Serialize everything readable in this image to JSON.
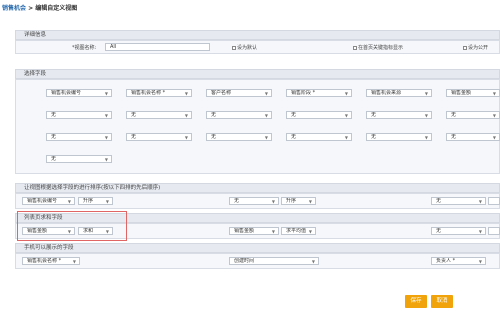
{
  "breadcrumb": {
    "link": "销售机会",
    "separator": " > ",
    "current": "编辑自定义视图"
  },
  "sections": {
    "details": "详细信息",
    "select_fields": "选择字段",
    "sort": "让视图根据选择字段的进行排序(按以下四排的先后顺序)",
    "summary": "列表页求和字段",
    "mobile": "手机可以展示的字段"
  },
  "details": {
    "view_name_label": "*视图名称:",
    "view_name_value": "All",
    "default_label": "设为默认",
    "home_key_label": "在首页关键指标显示",
    "public_label": "设为公开"
  },
  "fields": [
    [
      "销售机会编号",
      "销售机会名称 *",
      "客户名称",
      "销售阶段 *",
      "销售机会来源",
      "销售金额"
    ],
    [
      "无",
      "无",
      "无",
      "无",
      "无",
      "无"
    ],
    [
      "无",
      "无",
      "无",
      "无",
      "无",
      "无"
    ],
    [
      "无"
    ]
  ],
  "sort": [
    {
      "field": "销售机会编号",
      "order": "升序"
    },
    {
      "field": "无",
      "order": "升序"
    },
    {
      "field": "无",
      "order": ""
    }
  ],
  "summary": [
    {
      "field": "销售金额",
      "op": "求和"
    },
    {
      "field": "销售金额",
      "op": "求平均值"
    },
    {
      "field": "无",
      "op": ""
    }
  ],
  "mobile": [
    "销售机会名称 *",
    "创建时间",
    "负责人 *"
  ],
  "buttons": {
    "save": "保存",
    "cancel": "取消"
  },
  "colors": {
    "save": "#f0a30a",
    "cancel": "#f0a30a",
    "highlight": "#e06666",
    "link": "#2a6db0"
  },
  "icons": {
    "dropdown": "chevron-down-icon",
    "checkbox": "checkbox-icon"
  }
}
